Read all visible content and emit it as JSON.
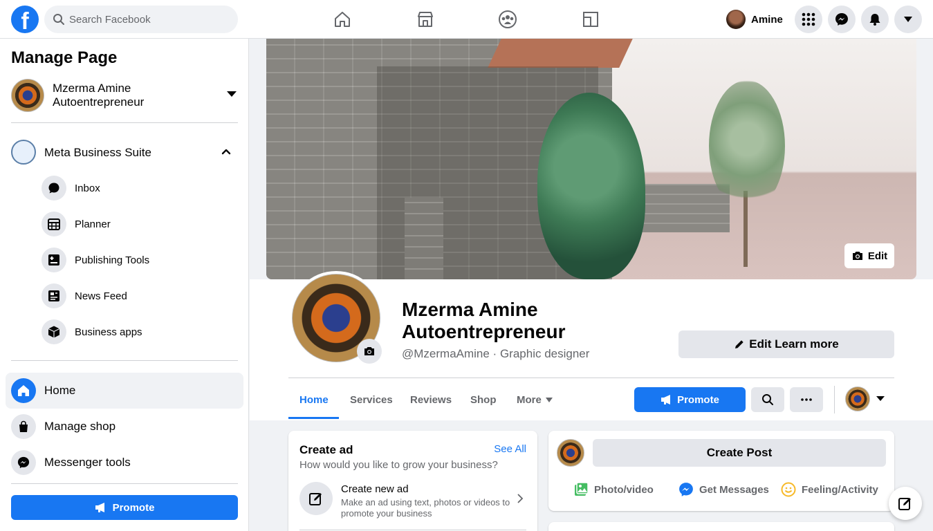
{
  "topbar": {
    "search_placeholder": "Search Facebook",
    "profile_name": "Amine",
    "nav_icons": [
      "home-icon",
      "marketplace-icon",
      "groups-icon",
      "gaming-icon"
    ],
    "right_icons": [
      "menu-grid-icon",
      "messenger-icon",
      "notifications-icon",
      "account-caret-icon"
    ]
  },
  "sidebar": {
    "title": "Manage Page",
    "page_name": "Mzerma Amine Autoentrepreneur",
    "business_suite_label": "Meta Business Suite",
    "suite_items": [
      {
        "label": "Inbox",
        "icon": "chat-icon"
      },
      {
        "label": "Planner",
        "icon": "calendar-icon"
      },
      {
        "label": "Publishing Tools",
        "icon": "publishing-icon"
      },
      {
        "label": "News Feed",
        "icon": "news-feed-icon"
      },
      {
        "label": "Business apps",
        "icon": "box-icon"
      }
    ],
    "main_items": [
      {
        "label": "Home",
        "icon": "home-icon",
        "active": true
      },
      {
        "label": "Manage shop",
        "icon": "shopping-bag-icon"
      },
      {
        "label": "Messenger tools",
        "icon": "messenger-icon"
      }
    ],
    "promote_label": "Promote"
  },
  "cover": {
    "edit_label": "Edit"
  },
  "profile": {
    "name": "Mzerma Amine Autoentrepreneur",
    "handle_line": "@MzermaAmine · Graphic designer",
    "edit_learn_more_label": "Edit Learn more"
  },
  "tabs": {
    "items": [
      "Home",
      "Services",
      "Reviews",
      "Shop",
      "More"
    ],
    "active": "Home",
    "promote_label": "Promote"
  },
  "create_ad": {
    "title": "Create ad",
    "see_all": "See All",
    "question": "How would you like to grow your business?",
    "new_ad_title": "Create new ad",
    "new_ad_desc": "Make an ad using text, photos or videos to promote your business"
  },
  "create_post": {
    "button_label": "Create Post",
    "actions": [
      {
        "label": "Photo/video",
        "color": "#45bd62"
      },
      {
        "label": "Get Messages",
        "color": "#1877f2"
      },
      {
        "label": "Feeling/Activity",
        "color": "#f7b928"
      }
    ]
  },
  "colors": {
    "brand": "#1877f2",
    "background": "#f0f2f5",
    "secondary_text": "#65676b"
  }
}
